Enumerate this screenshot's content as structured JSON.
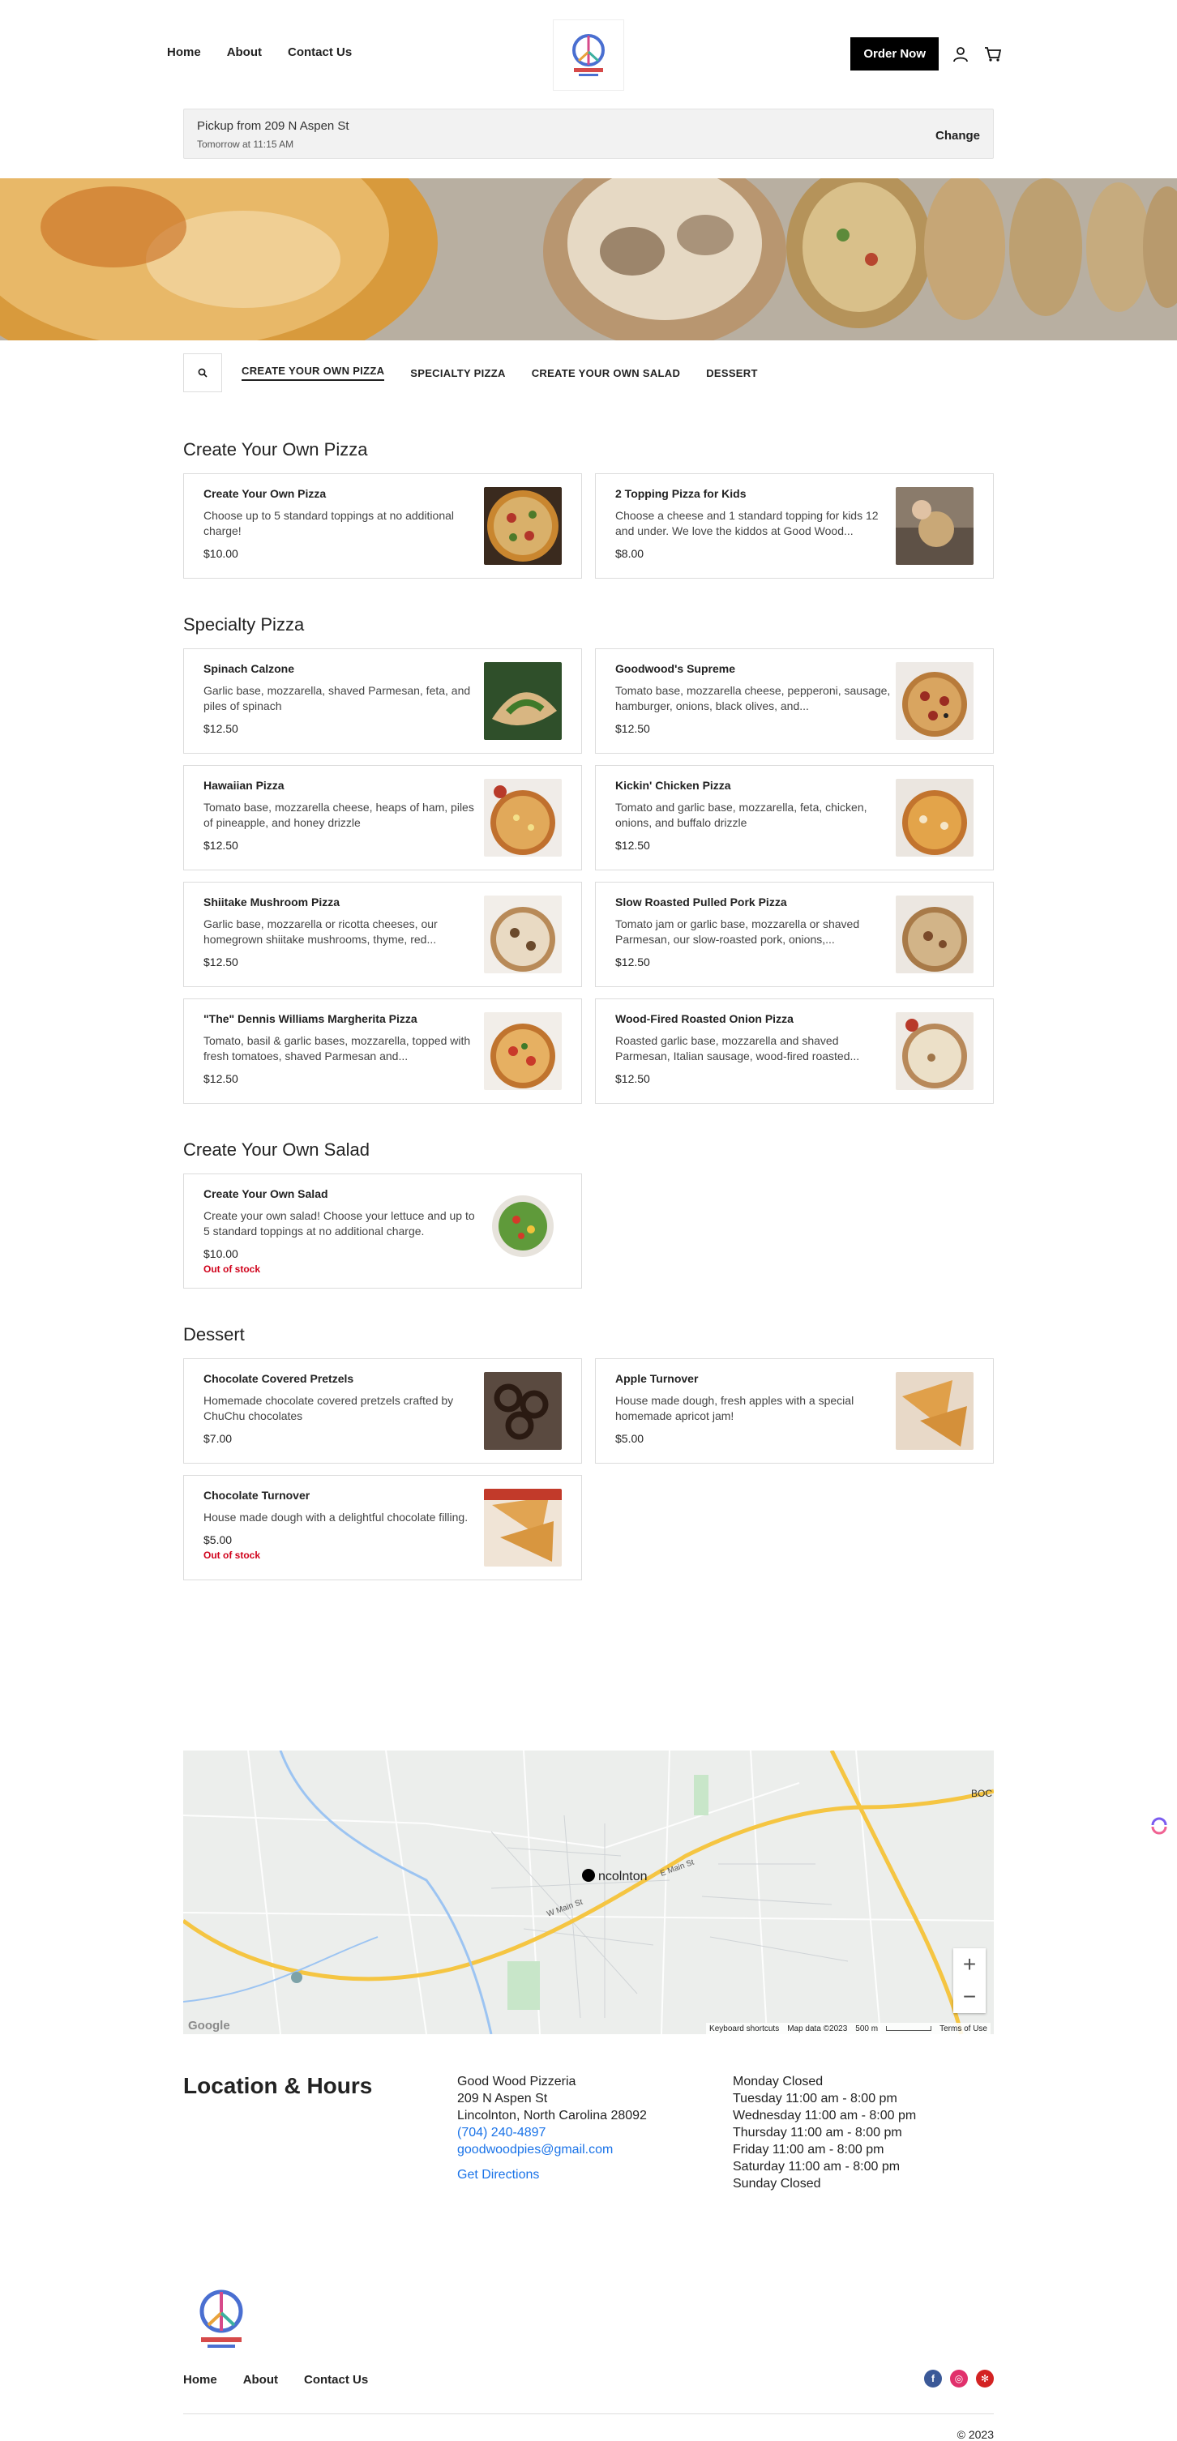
{
  "nav": {
    "home": "Home",
    "about": "About",
    "contact": "Contact Us",
    "order": "Order Now"
  },
  "pickup": {
    "title": "Pickup from 209 N Aspen St",
    "time": "Tomorrow at 11:15 AM",
    "change": "Change"
  },
  "tabs": [
    "CREATE YOUR OWN PIZZA",
    "SPECIALTY PIZZA",
    "CREATE YOUR OWN SALAD",
    "DESSERT"
  ],
  "sections": [
    {
      "title": "Create Your Own Pizza",
      "items": [
        {
          "name": "Create Your Own Pizza",
          "desc": "Choose up to 5 standard toppings at no additional charge!",
          "price": "$10.00"
        },
        {
          "name": "2 Topping Pizza for Kids",
          "desc": "Choose a cheese and 1 standard topping for kids 12 and under. We love the kiddos at Good Wood...",
          "price": "$8.00"
        }
      ]
    },
    {
      "title": "Specialty Pizza",
      "items": [
        {
          "name": "Spinach Calzone",
          "desc": "Garlic base, mozzarella, shaved Parmesan, feta, and piles of spinach",
          "price": "$12.50"
        },
        {
          "name": "Goodwood's Supreme",
          "desc": "Tomato base, mozzarella cheese, pepperoni, sausage, hamburger, onions, black olives, and...",
          "price": "$12.50"
        },
        {
          "name": "Hawaiian Pizza",
          "desc": "Tomato base, mozzarella cheese, heaps of ham, piles of pineapple, and honey drizzle",
          "price": "$12.50"
        },
        {
          "name": "Kickin' Chicken Pizza",
          "desc": "Tomato and garlic base, mozzarella, feta, chicken, onions, and buffalo drizzle",
          "price": "$12.50"
        },
        {
          "name": "Shiitake Mushroom Pizza",
          "desc": "Garlic base, mozzarella or ricotta cheeses, our homegrown shiitake mushrooms, thyme, red...",
          "price": "$12.50"
        },
        {
          "name": "Slow Roasted Pulled Pork Pizza",
          "desc": "Tomato jam or garlic base, mozzarella or shaved Parmesan, our slow-roasted pork, onions,...",
          "price": "$12.50"
        },
        {
          "name": "\"The\" Dennis Williams Margherita Pizza",
          "desc": "Tomato, basil & garlic bases, mozzarella, topped with fresh tomatoes, shaved Parmesan and...",
          "price": "$12.50"
        },
        {
          "name": "Wood-Fired Roasted Onion Pizza",
          "desc": "Roasted garlic base, mozzarella and shaved Parmesan, Italian sausage, wood-fired roasted...",
          "price": "$12.50"
        }
      ]
    },
    {
      "title": "Create Your Own Salad",
      "items": [
        {
          "name": "Create Your Own Salad",
          "desc": "Create your own salad! Choose your lettuce and up to 5 standard toppings at no additional charge.",
          "price": "$10.00",
          "oos": "Out of stock"
        }
      ]
    },
    {
      "title": "Dessert",
      "items": [
        {
          "name": "Chocolate Covered Pretzels",
          "desc": "Homemade chocolate covered pretzels crafted by ChuChu chocolates",
          "price": "$7.00"
        },
        {
          "name": "Apple Turnover",
          "desc": "House made dough, fresh apples with a special homemade apricot jam!",
          "price": "$5.00"
        },
        {
          "name": "Chocolate Turnover",
          "desc": "House made dough with a delightful chocolate filling.",
          "price": "$5.00",
          "oos": "Out of stock"
        }
      ]
    }
  ],
  "map": {
    "place": "ncolnton",
    "road_label": "E Main St",
    "road2": "W Main St",
    "attribution": "Keyboard shortcuts",
    "mapdata": "Map data ©2023",
    "scale": "500 m",
    "terms": "Terms of Use",
    "google": "Google",
    "boc": "BOC",
    "zoom_in": "+",
    "zoom_out": "−"
  },
  "location": {
    "title": "Location & Hours",
    "name": "Good Wood Pizzeria",
    "street": "209 N Aspen St",
    "city": "Lincolnton, North Carolina 28092",
    "phone": "(704) 240-4897",
    "email": "goodwoodpies@gmail.com",
    "directions": "Get Directions",
    "hours": [
      "Monday Closed",
      "Tuesday 11:00 am - 8:00 pm",
      "Wednesday 11:00 am - 8:00 pm",
      "Thursday 11:00 am - 8:00 pm",
      "Friday 11:00 am - 8:00 pm",
      "Saturday 11:00 am - 8:00 pm",
      "Sunday Closed"
    ]
  },
  "footer": {
    "home": "Home",
    "about": "About",
    "contact": "Contact Us",
    "copyright": "© 2023"
  }
}
